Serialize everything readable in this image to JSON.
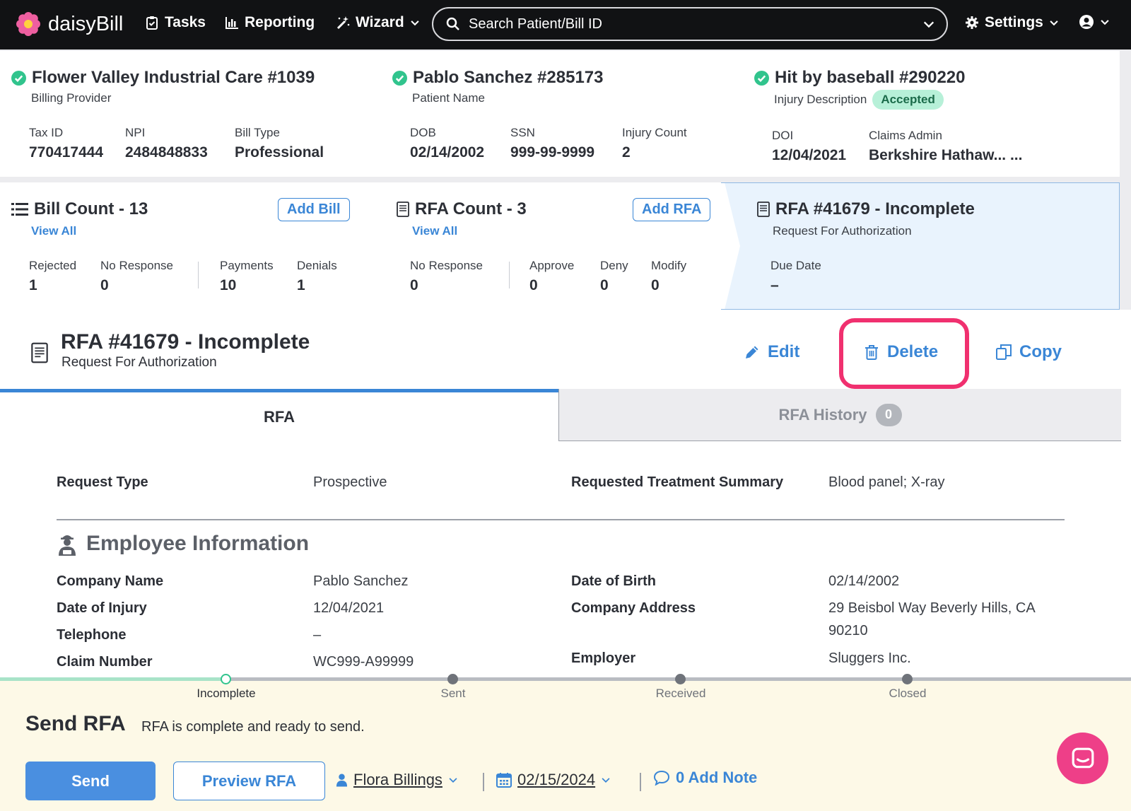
{
  "nav": {
    "brand": "daisyBill",
    "tasks": "Tasks",
    "reporting": "Reporting",
    "wizard": "Wizard",
    "search_placeholder": "Search Patient/Bill ID",
    "settings": "Settings"
  },
  "provider": {
    "title": "Flower Valley Industrial Care #1039",
    "subtitle": "Billing Provider",
    "tax_id_label": "Tax ID",
    "tax_id": "770417444",
    "npi_label": "NPI",
    "npi": "2484848833",
    "bill_type_label": "Bill Type",
    "bill_type": "Professional"
  },
  "patient": {
    "title": "Pablo Sanchez #285173",
    "subtitle": "Patient Name",
    "dob_label": "DOB",
    "dob": "02/14/2002",
    "ssn_label": "SSN",
    "ssn": "999-99-9999",
    "injury_count_label": "Injury Count",
    "injury_count": "2"
  },
  "injury": {
    "title": "Hit by baseball #290220",
    "subtitle": "Injury Description",
    "status": "Accepted",
    "doi_label": "DOI",
    "doi": "12/04/2021",
    "claims_admin_label": "Claims Admin",
    "claims_admin": "Berkshire Hathaw... ..."
  },
  "bills": {
    "title": "Bill Count - 13",
    "add": "Add Bill",
    "view_all": "View All",
    "rejected_label": "Rejected",
    "rejected": "1",
    "no_response_label": "No Response",
    "no_response": "0",
    "payments_label": "Payments",
    "payments": "10",
    "denials_label": "Denials",
    "denials": "1"
  },
  "rfas": {
    "title": "RFA Count - 3",
    "add": "Add RFA",
    "view_all": "View All",
    "no_response_label": "No Response",
    "no_response": "0",
    "approve_label": "Approve",
    "approve": "0",
    "deny_label": "Deny",
    "deny": "0",
    "modify_label": "Modify",
    "modify": "0"
  },
  "current_rfa_card": {
    "title": "RFA #41679 - Incomplete",
    "subtitle": "Request For Authorization",
    "due_date_label": "Due Date",
    "due_date": "–"
  },
  "rfa_header": {
    "title": "RFA #41679 - Incomplete",
    "subtitle": "Request For Authorization",
    "edit": "Edit",
    "delete": "Delete",
    "copy": "Copy"
  },
  "tabs": {
    "rfa": "RFA",
    "history": "RFA History",
    "history_count": "0"
  },
  "details": {
    "request_type_label": "Request Type",
    "request_type": "Prospective",
    "treatment_summary_label": "Requested Treatment Summary",
    "treatment_summary": "Blood panel; X-ray",
    "employee_section": "Employee Information",
    "company_name_label": "Company Name",
    "company_name": "Pablo Sanchez",
    "date_of_injury_label": "Date of Injury",
    "date_of_injury": "12/04/2021",
    "telephone_label": "Telephone",
    "telephone": "–",
    "claim_number_label": "Claim Number",
    "claim_number": "WC999-A99999",
    "date_of_birth_label": "Date of Birth",
    "date_of_birth": "02/14/2002",
    "company_address_label": "Company Address",
    "company_address_line1": "29 Beisbol Way Beverly Hills, CA",
    "company_address_line2": "90210",
    "employer_label": "Employer",
    "employer": "Sluggers Inc."
  },
  "progress": {
    "steps": [
      "Incomplete",
      "Sent",
      "Received",
      "Closed"
    ],
    "current": 0
  },
  "send_panel": {
    "title": "Send RFA",
    "subtitle": "RFA is complete and ready to send.",
    "send": "Send",
    "preview": "Preview RFA",
    "assignee": "Flora Billings",
    "date": "02/15/2024",
    "note": "0 Add Note"
  },
  "colors": {
    "accent": "#3a86d6",
    "highlight_ring": "#f0306f",
    "accepted_badge": "#b7f0d8",
    "chat": "#ee3f88"
  }
}
